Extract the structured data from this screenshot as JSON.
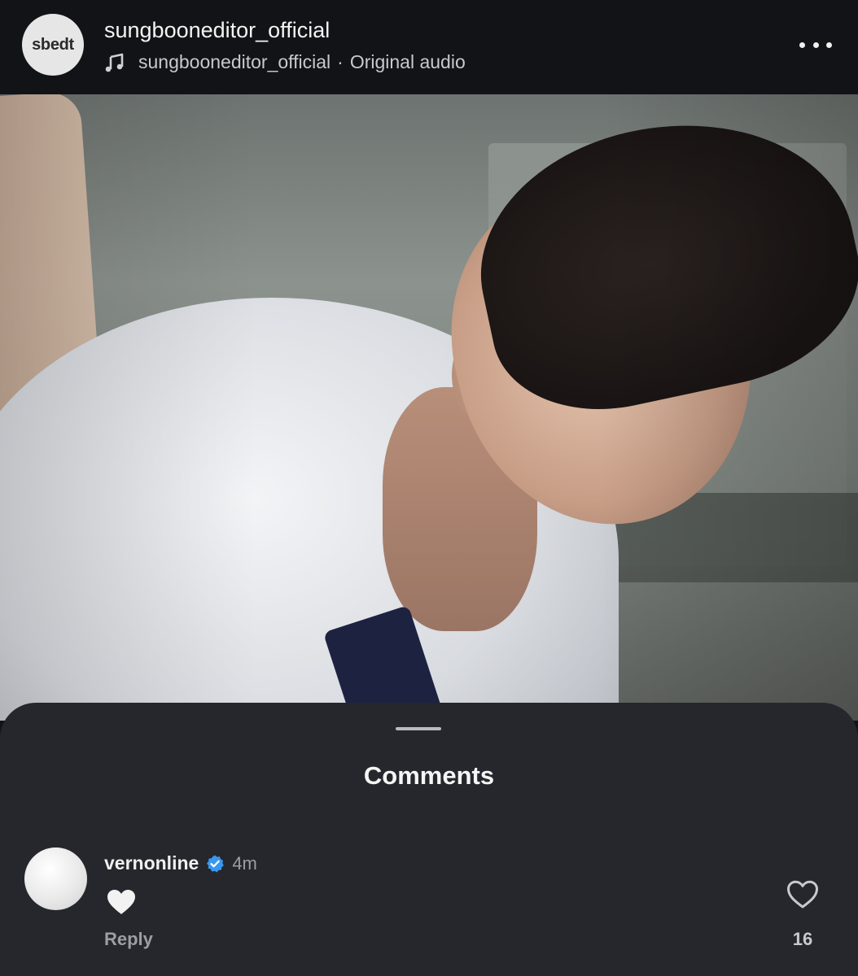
{
  "header": {
    "avatar_text": "sbedt",
    "username": "sungbooneditor_official",
    "audio_user": "sungbooneditor_official",
    "audio_separator": "·",
    "audio_title": "Original audio",
    "more_icon": "more-horizontal-icon"
  },
  "video": {
    "icon": "video-frame"
  },
  "comments_sheet": {
    "title": "Comments",
    "comments": [
      {
        "username": "vernonline",
        "verified": true,
        "time": "4m",
        "text": "🤍",
        "reply_label": "Reply",
        "like_count": "16"
      }
    ]
  },
  "colors": {
    "background": "#121316",
    "sheet": "#25272c",
    "verified_blue": "#3897f0"
  }
}
